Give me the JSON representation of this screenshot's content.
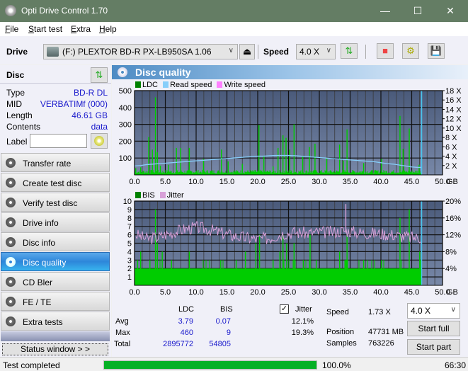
{
  "window": {
    "title": "Opti Drive Control 1.70",
    "minimize": "—",
    "maximize": "☐",
    "close": "✕"
  },
  "menu": [
    {
      "label": "File",
      "accel": "F",
      "rest": "ile"
    },
    {
      "label": "Start test",
      "accel": "S",
      "rest": "tart test"
    },
    {
      "label": "Extra",
      "accel": "E",
      "rest": "xtra"
    },
    {
      "label": "Help",
      "accel": "H",
      "rest": "elp"
    }
  ],
  "toolbar": {
    "drive_label": "Drive",
    "drive_value": "(F:)  PLEXTOR BD-R  PX-LB950SA 1.06",
    "speed_label": "Speed",
    "speed_value": "4.0 X",
    "icons": [
      "eject-icon",
      "refresh-icon",
      "eraser-icon",
      "settings-icon",
      "save-icon"
    ]
  },
  "disc": {
    "title": "Disc",
    "rows": [
      {
        "key": "Type",
        "value": "BD-R DL"
      },
      {
        "key": "MID",
        "value": "VERBATIMf (000)"
      },
      {
        "key": "Length",
        "value": "46.61 GB"
      },
      {
        "key": "Contents",
        "value": "data"
      }
    ],
    "label_key": "Label",
    "label_value": ""
  },
  "nav": [
    {
      "label": "Transfer rate",
      "active": false
    },
    {
      "label": "Create test disc",
      "active": false
    },
    {
      "label": "Verify test disc",
      "active": false
    },
    {
      "label": "Drive info",
      "active": false
    },
    {
      "label": "Disc info",
      "active": false
    },
    {
      "label": "Disc quality",
      "active": true
    },
    {
      "label": "CD Bler",
      "active": false
    },
    {
      "label": "FE / TE",
      "active": false
    },
    {
      "label": "Extra tests",
      "active": false
    }
  ],
  "status_window_label": "Status window > >",
  "panel_title": "Disc quality",
  "colors": {
    "ldc": "#008000",
    "read_speed": "#87cefa",
    "write_speed": "#ff80ff",
    "bis": "#008000",
    "jitter": "#d8a0d8",
    "bar_green": "#00cc00",
    "plot_bg_top": "#4a5a7a",
    "plot_bg_bottom": "#7888a8"
  },
  "chart_data": [
    {
      "type": "bar",
      "title": "LDC",
      "legend": [
        "LDC",
        "Read speed",
        "Write speed"
      ],
      "xlabel": "GB",
      "x_ticks": [
        "0.0",
        "5.0",
        "10.0",
        "15.0",
        "20.0",
        "25.0",
        "30.0",
        "35.0",
        "40.0",
        "45.0",
        "50.0"
      ],
      "y_ticks_left": [
        "100",
        "200",
        "300",
        "400",
        "500"
      ],
      "y_ticks_right": [
        "2 X",
        "4 X",
        "6 X",
        "8 X",
        "10 X",
        "12 X",
        "14 X",
        "16 X",
        "18 X"
      ],
      "xlim": [
        0,
        50
      ],
      "ylim": [
        0,
        500
      ],
      "y2lim": [
        0,
        18
      ],
      "grid": true,
      "end_marker_gb": 46.61,
      "ldc_spikes": [
        [
          0.2,
          40
        ],
        [
          1.0,
          45
        ],
        [
          2.3,
          225
        ],
        [
          2.9,
          150
        ],
        [
          3.4,
          460
        ],
        [
          3.7,
          135
        ],
        [
          4.2,
          55
        ],
        [
          5.5,
          60
        ],
        [
          6.8,
          160
        ],
        [
          7.5,
          160
        ],
        [
          8.9,
          160
        ],
        [
          11.2,
          95
        ],
        [
          14.1,
          150
        ],
        [
          15.2,
          80
        ],
        [
          17.5,
          65
        ],
        [
          20.2,
          295
        ],
        [
          21.0,
          110
        ],
        [
          22.5,
          50
        ],
        [
          23.3,
          160
        ],
        [
          24.1,
          235
        ],
        [
          24.6,
          220
        ],
        [
          25.2,
          150
        ],
        [
          25.9,
          300
        ],
        [
          27.3,
          110
        ],
        [
          28.4,
          165
        ],
        [
          29.3,
          185
        ],
        [
          31.2,
          100
        ],
        [
          33.3,
          180
        ],
        [
          33.9,
          85
        ],
        [
          34.5,
          270
        ],
        [
          37.2,
          70
        ],
        [
          40.1,
          95
        ],
        [
          43.1,
          350
        ],
        [
          43.6,
          155
        ],
        [
          44.6,
          275
        ],
        [
          46.2,
          60
        ]
      ],
      "ldc_baseline": 25,
      "read_speed_x": [
        0,
        1,
        2,
        3,
        4,
        5,
        6,
        7,
        8,
        9,
        10,
        11,
        12,
        13,
        14,
        15,
        16,
        17,
        18,
        19,
        20,
        21,
        22,
        23,
        24,
        25,
        26,
        27,
        28,
        29,
        30,
        31,
        32,
        33,
        34,
        35,
        36,
        37,
        38,
        39,
        40,
        41,
        42,
        43,
        44,
        45,
        46,
        46.61
      ],
      "read_speed_y": [
        1.9,
        2.0,
        2.2,
        2.3,
        2.4,
        2.5,
        2.6,
        2.7,
        2.8,
        2.9,
        3.0,
        3.1,
        3.2,
        3.3,
        3.4,
        3.5,
        3.6,
        3.7,
        3.8,
        3.9,
        4.0,
        4.0,
        4.1,
        4.15,
        4.15,
        4.15,
        4.1,
        4.0,
        3.9,
        3.8,
        3.7,
        3.6,
        3.5,
        3.4,
        3.3,
        3.2,
        3.1,
        3.0,
        2.9,
        2.8,
        2.6,
        2.4,
        2.3,
        2.1,
        1.9,
        1.7,
        1.6,
        1.6
      ]
    },
    {
      "type": "bar",
      "title": "BIS",
      "legend": [
        "BIS",
        "Jitter"
      ],
      "xlabel": "GB",
      "x_ticks": [
        "0.0",
        "5.0",
        "10.0",
        "15.0",
        "20.0",
        "25.0",
        "30.0",
        "35.0",
        "40.0",
        "45.0",
        "50.0"
      ],
      "y_ticks_left": [
        "1",
        "2",
        "3",
        "4",
        "5",
        "6",
        "7",
        "8",
        "9",
        "10"
      ],
      "y_ticks_right": [
        "4%",
        "8%",
        "12%",
        "16%",
        "20%"
      ],
      "xlim": [
        0,
        50
      ],
      "ylim": [
        0,
        10
      ],
      "y2lim": [
        0,
        20
      ],
      "grid": true,
      "end_marker_gb": 46.61,
      "bis_spikes": [
        [
          0.5,
          3
        ],
        [
          1.0,
          4
        ],
        [
          2.5,
          3
        ],
        [
          3.4,
          9
        ],
        [
          3.7,
          5
        ],
        [
          4.5,
          4
        ],
        [
          6.0,
          3
        ],
        [
          8.9,
          4
        ],
        [
          14.0,
          3
        ],
        [
          16.5,
          3
        ],
        [
          18.0,
          4
        ],
        [
          19.7,
          5
        ],
        [
          20.3,
          6
        ],
        [
          22.5,
          3
        ],
        [
          23.6,
          4
        ],
        [
          24.1,
          6
        ],
        [
          24.7,
          5
        ],
        [
          25.9,
          5
        ],
        [
          27.4,
          3
        ],
        [
          28.5,
          6
        ],
        [
          29.5,
          3
        ],
        [
          33.3,
          4
        ],
        [
          34.5,
          6
        ],
        [
          37.2,
          3
        ],
        [
          40.1,
          3
        ],
        [
          43.1,
          8
        ],
        [
          44.6,
          9
        ],
        [
          46.3,
          4
        ]
      ],
      "bis_baseline": 2,
      "jitter_x": [
        0,
        2,
        4,
        6,
        8,
        10,
        12,
        14,
        16,
        18,
        20,
        22,
        24,
        26,
        28,
        30,
        32,
        34,
        36,
        38,
        40,
        42,
        44,
        46,
        46.61
      ],
      "jitter_y": [
        12.2,
        11.0,
        11.5,
        12.5,
        13.3,
        13.8,
        13.3,
        12.5,
        11.8,
        11.3,
        11.0,
        11.3,
        12.3,
        12.6,
        12.4,
        12.6,
        12.6,
        13.0,
        12.6,
        12.4,
        12.3,
        12.0,
        11.5,
        11.3,
        11.4
      ]
    }
  ],
  "stats": {
    "col_ldc": "LDC",
    "col_bis": "BIS",
    "jitter_label": "Jitter",
    "jitter_checked": true,
    "rows": [
      {
        "label": "Avg",
        "ldc": "3.79",
        "bis": "0.07",
        "jitter": "12.1%"
      },
      {
        "label": "Max",
        "ldc": "460",
        "bis": "9",
        "jitter": "19.3%"
      },
      {
        "label": "Total",
        "ldc": "2895772",
        "bis": "54805",
        "jitter": ""
      }
    ],
    "speed_label": "Speed",
    "speed_value": "1.73 X",
    "position_label": "Position",
    "position_value": "47731 MB",
    "samples_label": "Samples",
    "samples_value": "763226",
    "speed_select": "4.0 X",
    "start_full": "Start full",
    "start_part": "Start part"
  },
  "statusbar": {
    "text": "Test completed",
    "progress_percent": 100.0,
    "progress_label": "100.0%",
    "time": "66:30"
  }
}
